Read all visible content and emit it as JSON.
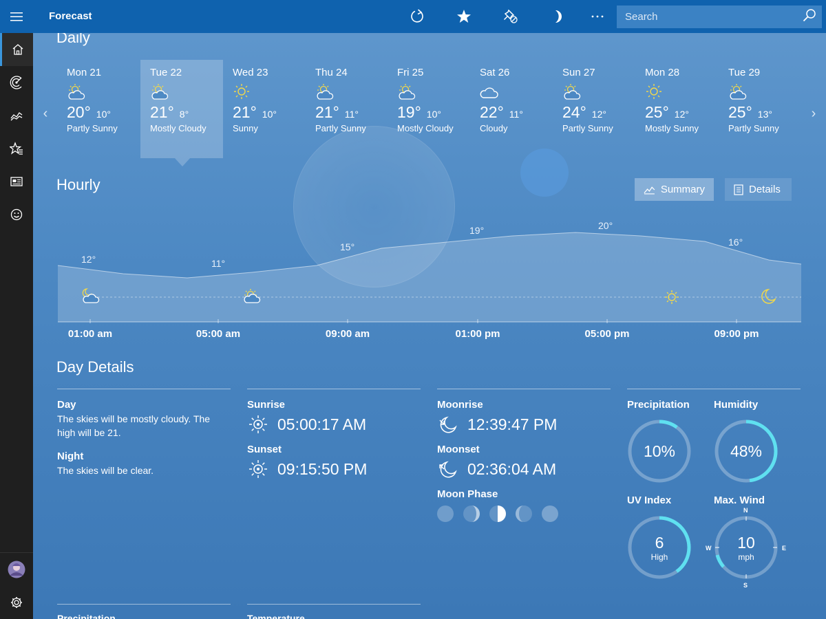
{
  "app": {
    "title": "Forecast"
  },
  "toolbar": {
    "buttons": [
      "refresh-icon",
      "favorite-star-icon",
      "pin-icon",
      "night-mode-icon",
      "more-icon"
    ],
    "search_placeholder": "Search"
  },
  "sidebar": {
    "items": [
      "home-icon",
      "maps-icon",
      "historical-weather-icon",
      "favorites-icon",
      "news-icon",
      "feedback-icon"
    ],
    "bottom": [
      "avatar",
      "settings-icon"
    ]
  },
  "daily": {
    "heading": "Daily",
    "days": [
      {
        "date": "Mon 21",
        "high": "20°",
        "low": "10°",
        "condition": "Partly Sunny",
        "icon": "partly-sunny"
      },
      {
        "date": "Tue 22",
        "high": "21°",
        "low": "8°",
        "condition": "Mostly Cloudy",
        "icon": "partly-sunny"
      },
      {
        "date": "Wed 23",
        "high": "21°",
        "low": "10°",
        "condition": "Sunny",
        "icon": "sunny"
      },
      {
        "date": "Thu 24",
        "high": "21°",
        "low": "11°",
        "condition": "Partly Sunny",
        "icon": "partly-sunny"
      },
      {
        "date": "Fri 25",
        "high": "19°",
        "low": "10°",
        "condition": "Mostly Cloudy",
        "icon": "partly-sunny"
      },
      {
        "date": "Sat 26",
        "high": "22°",
        "low": "11°",
        "condition": "Cloudy",
        "icon": "cloudy"
      },
      {
        "date": "Sun 27",
        "high": "24°",
        "low": "12°",
        "condition": "Partly Sunny",
        "icon": "partly-sunny"
      },
      {
        "date": "Mon 28",
        "high": "25°",
        "low": "12°",
        "condition": "Mostly Sunny",
        "icon": "sunny"
      },
      {
        "date": "Tue 29",
        "high": "25°",
        "low": "13°",
        "condition": "Partly Sunny",
        "icon": "partly-sunny"
      }
    ],
    "selected_index": 1
  },
  "hourly": {
    "heading": "Hourly",
    "summary_label": "Summary",
    "details_label": "Details",
    "temp_labels": [
      "12°",
      "11°",
      "15°",
      "19°",
      "20°",
      "16°"
    ],
    "time_labels": [
      "01:00 am",
      "05:00 am",
      "09:00 am",
      "01:00 pm",
      "05:00 pm",
      "09:00 pm"
    ]
  },
  "day_details": {
    "heading": "Day Details",
    "day_label": "Day",
    "day_text": "The skies will be mostly cloudy. The high will be 21.",
    "night_label": "Night",
    "night_text": "The skies will be clear.",
    "sunrise_label": "Sunrise",
    "sunrise": "05:00:17 AM",
    "sunset_label": "Sunset",
    "sunset": "09:15:50 PM",
    "moonrise_label": "Moonrise",
    "moonrise": "12:39:47 PM",
    "moonset_label": "Moonset",
    "moonset": "02:36:04 AM",
    "moon_phase_label": "Moon Phase",
    "precip_label": "Precipitation",
    "precip_value": "10%",
    "precip_fraction": 0.1,
    "humidity_label": "Humidity",
    "humidity_value": "48%",
    "humidity_fraction": 0.48,
    "uv_label": "UV Index",
    "uv_value": "6",
    "uv_desc": "High",
    "uv_fraction": 0.4,
    "wind_label": "Max. Wind",
    "wind_value": "10",
    "wind_unit": "mph",
    "compass": {
      "n": "N",
      "e": "E",
      "s": "S",
      "w": "W"
    }
  },
  "bottom_sections": [
    "Precipitation",
    "Temperature"
  ],
  "colors": {
    "topbar": "#0f62ae",
    "sidebar": "#1f1f1f",
    "accent": "#5fe0f0",
    "sun": "#f2d84a"
  }
}
